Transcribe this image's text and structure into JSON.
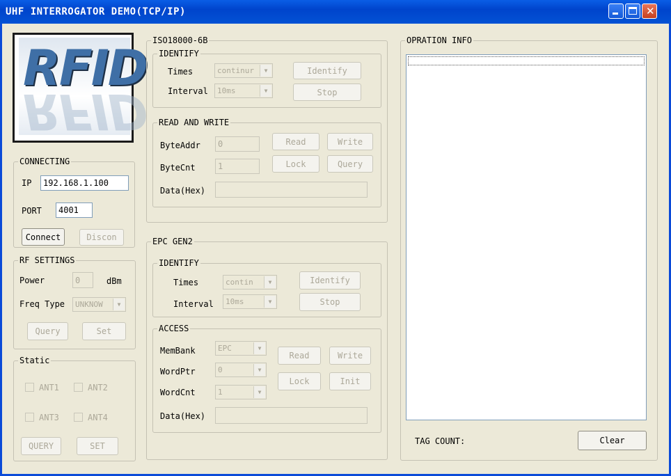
{
  "window": {
    "title": "UHF INTERROGATOR DEMO(TCP/IP)"
  },
  "logo": {
    "text": "RFID"
  },
  "connecting": {
    "legend": "CONNECTING",
    "ip_label": "IP",
    "ip_value": "192.168.1.100",
    "port_label": "PORT",
    "port_value": "4001",
    "connect": "Connect",
    "disconnect": "Discon"
  },
  "rf": {
    "legend": "RF SETTINGS",
    "power_label": "Power",
    "power_value": "0",
    "power_unit": "dBm",
    "freq_label": "Freq Type",
    "freq_value": "UNKNOW",
    "query": "Query",
    "set": "Set"
  },
  "static": {
    "legend": "Static",
    "ant1": "ANT1",
    "ant2": "ANT2",
    "ant3": "ANT3",
    "ant4": "ANT4",
    "query": "QUERY",
    "set": "SET"
  },
  "iso": {
    "legend": "ISO18000-6B",
    "identify": {
      "legend": "IDENTIFY",
      "times_label": "Times",
      "times_value": "continur",
      "interval_label": "Interval",
      "interval_value": "10ms",
      "identify": "Identify",
      "stop": "Stop"
    },
    "rw": {
      "legend": "READ AND WRITE",
      "byteaddr_label": "ByteAddr",
      "byteaddr_value": "0",
      "bytecnt_label": "ByteCnt",
      "bytecnt_value": "1",
      "data_label": "Data(Hex)",
      "read": "Read",
      "write": "Write",
      "lock": "Lock",
      "query": "Query"
    }
  },
  "gen2": {
    "legend": "EPC GEN2",
    "identify": {
      "legend": "IDENTIFY",
      "times_label": "Times",
      "times_value": "contin",
      "interval_label": "Interval",
      "interval_value": "10ms",
      "identify": "Identify",
      "stop": "Stop"
    },
    "access": {
      "legend": "ACCESS",
      "membank_label": "MemBank",
      "membank_value": "EPC",
      "wordptr_label": "WordPtr",
      "wordptr_value": "0",
      "wordcnt_label": "WordCnt",
      "wordcnt_value": "1",
      "data_label": "Data(Hex)",
      "read": "Read",
      "write": "Write",
      "lock": "Lock",
      "init": "Init"
    }
  },
  "info": {
    "legend": "OPRATION INFO",
    "tag_count_label": "TAG COUNT:",
    "clear": "Clear"
  },
  "colors": {
    "titlebar": "#0a5ee6",
    "face": "#ece9d8"
  }
}
